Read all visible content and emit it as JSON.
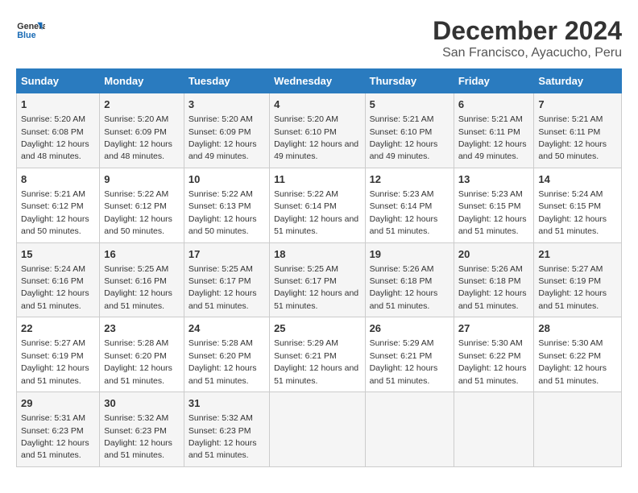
{
  "logo": {
    "line1": "General",
    "line2": "Blue"
  },
  "title": "December 2024",
  "subtitle": "San Francisco, Ayacucho, Peru",
  "days_of_week": [
    "Sunday",
    "Monday",
    "Tuesday",
    "Wednesday",
    "Thursday",
    "Friday",
    "Saturday"
  ],
  "weeks": [
    [
      {
        "day": "1",
        "sunrise": "5:20 AM",
        "sunset": "6:08 PM",
        "daylight": "12 hours and 48 minutes."
      },
      {
        "day": "2",
        "sunrise": "5:20 AM",
        "sunset": "6:09 PM",
        "daylight": "12 hours and 48 minutes."
      },
      {
        "day": "3",
        "sunrise": "5:20 AM",
        "sunset": "6:09 PM",
        "daylight": "12 hours and 49 minutes."
      },
      {
        "day": "4",
        "sunrise": "5:20 AM",
        "sunset": "6:10 PM",
        "daylight": "12 hours and 49 minutes."
      },
      {
        "day": "5",
        "sunrise": "5:21 AM",
        "sunset": "6:10 PM",
        "daylight": "12 hours and 49 minutes."
      },
      {
        "day": "6",
        "sunrise": "5:21 AM",
        "sunset": "6:11 PM",
        "daylight": "12 hours and 49 minutes."
      },
      {
        "day": "7",
        "sunrise": "5:21 AM",
        "sunset": "6:11 PM",
        "daylight": "12 hours and 50 minutes."
      }
    ],
    [
      {
        "day": "8",
        "sunrise": "5:21 AM",
        "sunset": "6:12 PM",
        "daylight": "12 hours and 50 minutes."
      },
      {
        "day": "9",
        "sunrise": "5:22 AM",
        "sunset": "6:12 PM",
        "daylight": "12 hours and 50 minutes."
      },
      {
        "day": "10",
        "sunrise": "5:22 AM",
        "sunset": "6:13 PM",
        "daylight": "12 hours and 50 minutes."
      },
      {
        "day": "11",
        "sunrise": "5:22 AM",
        "sunset": "6:14 PM",
        "daylight": "12 hours and 51 minutes."
      },
      {
        "day": "12",
        "sunrise": "5:23 AM",
        "sunset": "6:14 PM",
        "daylight": "12 hours and 51 minutes."
      },
      {
        "day": "13",
        "sunrise": "5:23 AM",
        "sunset": "6:15 PM",
        "daylight": "12 hours and 51 minutes."
      },
      {
        "day": "14",
        "sunrise": "5:24 AM",
        "sunset": "6:15 PM",
        "daylight": "12 hours and 51 minutes."
      }
    ],
    [
      {
        "day": "15",
        "sunrise": "5:24 AM",
        "sunset": "6:16 PM",
        "daylight": "12 hours and 51 minutes."
      },
      {
        "day": "16",
        "sunrise": "5:25 AM",
        "sunset": "6:16 PM",
        "daylight": "12 hours and 51 minutes."
      },
      {
        "day": "17",
        "sunrise": "5:25 AM",
        "sunset": "6:17 PM",
        "daylight": "12 hours and 51 minutes."
      },
      {
        "day": "18",
        "sunrise": "5:25 AM",
        "sunset": "6:17 PM",
        "daylight": "12 hours and 51 minutes."
      },
      {
        "day": "19",
        "sunrise": "5:26 AM",
        "sunset": "6:18 PM",
        "daylight": "12 hours and 51 minutes."
      },
      {
        "day": "20",
        "sunrise": "5:26 AM",
        "sunset": "6:18 PM",
        "daylight": "12 hours and 51 minutes."
      },
      {
        "day": "21",
        "sunrise": "5:27 AM",
        "sunset": "6:19 PM",
        "daylight": "12 hours and 51 minutes."
      }
    ],
    [
      {
        "day": "22",
        "sunrise": "5:27 AM",
        "sunset": "6:19 PM",
        "daylight": "12 hours and 51 minutes."
      },
      {
        "day": "23",
        "sunrise": "5:28 AM",
        "sunset": "6:20 PM",
        "daylight": "12 hours and 51 minutes."
      },
      {
        "day": "24",
        "sunrise": "5:28 AM",
        "sunset": "6:20 PM",
        "daylight": "12 hours and 51 minutes."
      },
      {
        "day": "25",
        "sunrise": "5:29 AM",
        "sunset": "6:21 PM",
        "daylight": "12 hours and 51 minutes."
      },
      {
        "day": "26",
        "sunrise": "5:29 AM",
        "sunset": "6:21 PM",
        "daylight": "12 hours and 51 minutes."
      },
      {
        "day": "27",
        "sunrise": "5:30 AM",
        "sunset": "6:22 PM",
        "daylight": "12 hours and 51 minutes."
      },
      {
        "day": "28",
        "sunrise": "5:30 AM",
        "sunset": "6:22 PM",
        "daylight": "12 hours and 51 minutes."
      }
    ],
    [
      {
        "day": "29",
        "sunrise": "5:31 AM",
        "sunset": "6:23 PM",
        "daylight": "12 hours and 51 minutes."
      },
      {
        "day": "30",
        "sunrise": "5:32 AM",
        "sunset": "6:23 PM",
        "daylight": "12 hours and 51 minutes."
      },
      {
        "day": "31",
        "sunrise": "5:32 AM",
        "sunset": "6:23 PM",
        "daylight": "12 hours and 51 minutes."
      },
      null,
      null,
      null,
      null
    ]
  ]
}
